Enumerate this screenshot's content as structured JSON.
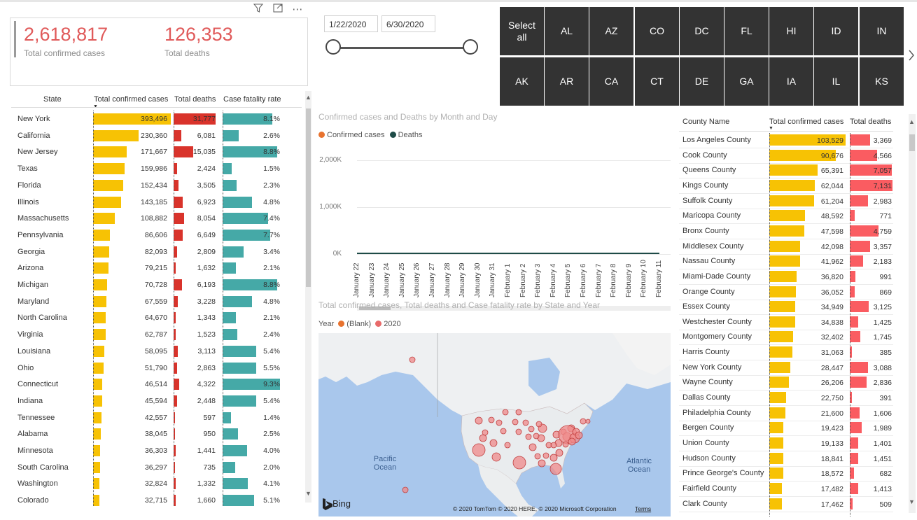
{
  "kpis": {
    "confirmed_value": "2,618,817",
    "confirmed_label": "Total confirmed cases",
    "deaths_value": "126,353",
    "deaths_label": "Total deaths"
  },
  "visual_icons": [
    "filter-icon",
    "focus-mode-icon",
    "more-options-icon"
  ],
  "date_slicer": {
    "start": "1/22/2020",
    "end": "6/30/2020"
  },
  "state_buttons": {
    "row1": [
      "Select all",
      "AL",
      "AZ",
      "CO",
      "DC",
      "FL",
      "HI",
      "ID",
      "IN"
    ],
    "row2": [
      "AK",
      "AR",
      "CA",
      "CT",
      "DE",
      "GA",
      "IA",
      "IL",
      "KS"
    ]
  },
  "state_table": {
    "headers": [
      "State",
      "Total confirmed cases",
      "Total deaths",
      "Case fatality rate"
    ],
    "rows": [
      {
        "state": "New York",
        "confirmed": "393,496",
        "deaths": "31,777",
        "cfr": "8.1%",
        "c": 393496,
        "d": 31777,
        "r": 8.1
      },
      {
        "state": "California",
        "confirmed": "230,360",
        "deaths": "6,081",
        "cfr": "2.6%",
        "c": 230360,
        "d": 6081,
        "r": 2.6
      },
      {
        "state": "New Jersey",
        "confirmed": "171,667",
        "deaths": "15,035",
        "cfr": "8.8%",
        "c": 171667,
        "d": 15035,
        "r": 8.8
      },
      {
        "state": "Texas",
        "confirmed": "159,986",
        "deaths": "2,424",
        "cfr": "1.5%",
        "c": 159986,
        "d": 2424,
        "r": 1.5
      },
      {
        "state": "Florida",
        "confirmed": "152,434",
        "deaths": "3,505",
        "cfr": "2.3%",
        "c": 152434,
        "d": 3505,
        "r": 2.3
      },
      {
        "state": "Illinois",
        "confirmed": "143,185",
        "deaths": "6,923",
        "cfr": "4.8%",
        "c": 143185,
        "d": 6923,
        "r": 4.8
      },
      {
        "state": "Massachusetts",
        "confirmed": "108,882",
        "deaths": "8,054",
        "cfr": "7.4%",
        "c": 108882,
        "d": 8054,
        "r": 7.4
      },
      {
        "state": "Pennsylvania",
        "confirmed": "86,606",
        "deaths": "6,649",
        "cfr": "7.7%",
        "c": 86606,
        "d": 6649,
        "r": 7.7
      },
      {
        "state": "Georgia",
        "confirmed": "82,093",
        "deaths": "2,809",
        "cfr": "3.4%",
        "c": 82093,
        "d": 2809,
        "r": 3.4
      },
      {
        "state": "Arizona",
        "confirmed": "79,215",
        "deaths": "1,632",
        "cfr": "2.1%",
        "c": 79215,
        "d": 1632,
        "r": 2.1
      },
      {
        "state": "Michigan",
        "confirmed": "70,728",
        "deaths": "6,193",
        "cfr": "8.8%",
        "c": 70728,
        "d": 6193,
        "r": 8.8
      },
      {
        "state": "Maryland",
        "confirmed": "67,559",
        "deaths": "3,228",
        "cfr": "4.8%",
        "c": 67559,
        "d": 3228,
        "r": 4.8
      },
      {
        "state": "North Carolina",
        "confirmed": "64,670",
        "deaths": "1,343",
        "cfr": "2.1%",
        "c": 64670,
        "d": 1343,
        "r": 2.1
      },
      {
        "state": "Virginia",
        "confirmed": "62,787",
        "deaths": "1,523",
        "cfr": "2.4%",
        "c": 62787,
        "d": 1523,
        "r": 2.4
      },
      {
        "state": "Louisiana",
        "confirmed": "58,095",
        "deaths": "3,113",
        "cfr": "5.4%",
        "c": 58095,
        "d": 3113,
        "r": 5.4
      },
      {
        "state": "Ohio",
        "confirmed": "51,790",
        "deaths": "2,863",
        "cfr": "5.5%",
        "c": 51790,
        "d": 2863,
        "r": 5.5
      },
      {
        "state": "Connecticut",
        "confirmed": "46,514",
        "deaths": "4,322",
        "cfr": "9.3%",
        "c": 46514,
        "d": 4322,
        "r": 9.3
      },
      {
        "state": "Indiana",
        "confirmed": "45,594",
        "deaths": "2,448",
        "cfr": "5.4%",
        "c": 45594,
        "d": 2448,
        "r": 5.4
      },
      {
        "state": "Tennessee",
        "confirmed": "42,557",
        "deaths": "597",
        "cfr": "1.4%",
        "c": 42557,
        "d": 597,
        "r": 1.4
      },
      {
        "state": "Alabama",
        "confirmed": "38,045",
        "deaths": "950",
        "cfr": "2.5%",
        "c": 38045,
        "d": 950,
        "r": 2.5
      },
      {
        "state": "Minnesota",
        "confirmed": "36,303",
        "deaths": "1,441",
        "cfr": "4.0%",
        "c": 36303,
        "d": 1441,
        "r": 4.0
      },
      {
        "state": "South Carolina",
        "confirmed": "36,297",
        "deaths": "735",
        "cfr": "2.0%",
        "c": 36297,
        "d": 735,
        "r": 2.0
      },
      {
        "state": "Washington",
        "confirmed": "32,824",
        "deaths": "1,332",
        "cfr": "4.1%",
        "c": 32824,
        "d": 1332,
        "r": 4.1
      },
      {
        "state": "Colorado",
        "confirmed": "32,715",
        "deaths": "1,660",
        "cfr": "5.1%",
        "c": 32715,
        "d": 1660,
        "r": 5.1
      }
    ]
  },
  "line_chart": {
    "title": "Confirmed cases and Deaths by Month and Day",
    "legend": [
      "Confirmed cases",
      "Deaths"
    ],
    "colors": {
      "confirmed": "#e8732f",
      "deaths": "#1e4b47"
    }
  },
  "chart_data": {
    "type": "line",
    "title": "Confirmed cases and Deaths by Month and Day",
    "x": [
      "January 22",
      "January 23",
      "January 24",
      "January 25",
      "January 26",
      "January 27",
      "January 28",
      "January 29",
      "January 30",
      "January 31",
      "February 1",
      "February 2",
      "February 3",
      "February 4",
      "February 5",
      "February 6",
      "February 7",
      "February 8",
      "February 9",
      "February 10",
      "February 11"
    ],
    "yticks": [
      "0K",
      "1,000K",
      "2,000K"
    ],
    "ylim": [
      0,
      2500000
    ],
    "series": [
      {
        "name": "Confirmed cases",
        "values": [
          0,
          0,
          0,
          0,
          0,
          0,
          0,
          0,
          0,
          0,
          0,
          0,
          0,
          0,
          0,
          0,
          0,
          0,
          0,
          0,
          0
        ]
      },
      {
        "name": "Deaths",
        "values": [
          0,
          0,
          0,
          0,
          0,
          0,
          0,
          0,
          0,
          0,
          0,
          0,
          0,
          0,
          0,
          0,
          0,
          0,
          0,
          0,
          0
        ]
      }
    ]
  },
  "map": {
    "title": "Total confirmed cases, Total deaths and Case fatality rate by State and Year",
    "legend_title": "Year",
    "legend": [
      "(Blank)",
      "2020"
    ],
    "colors": {
      "blank": "#e8732f",
      "y2020": "#e86a6a"
    },
    "labels": {
      "pacific": "Pacific\nOcean",
      "atlantic": "Atlantic\nOcean"
    },
    "logo": "Bing",
    "copyright": "© 2020 TomTom © 2020 HERE, © 2020 Microsoft Corporation",
    "terms": "Terms"
  },
  "county_table": {
    "headers": [
      "County Name",
      "Total confirmed cases",
      "Total deaths"
    ],
    "rows": [
      {
        "county": "Los Angeles County",
        "confirmed": "103,529",
        "deaths": "3,369",
        "c": 103529,
        "d": 3369
      },
      {
        "county": "Cook County",
        "confirmed": "90,676",
        "deaths": "4,566",
        "c": 90676,
        "d": 4566
      },
      {
        "county": "Queens County",
        "confirmed": "65,391",
        "deaths": "7,057",
        "c": 65391,
        "d": 7057
      },
      {
        "county": "Kings County",
        "confirmed": "62,044",
        "deaths": "7,131",
        "c": 62044,
        "d": 7131
      },
      {
        "county": "Suffolk County",
        "confirmed": "61,204",
        "deaths": "2,983",
        "c": 61204,
        "d": 2983
      },
      {
        "county": "Maricopa County",
        "confirmed": "48,592",
        "deaths": "771",
        "c": 48592,
        "d": 771
      },
      {
        "county": "Bronx County",
        "confirmed": "47,598",
        "deaths": "4,759",
        "c": 47598,
        "d": 4759
      },
      {
        "county": "Middlesex County",
        "confirmed": "42,098",
        "deaths": "3,357",
        "c": 42098,
        "d": 3357
      },
      {
        "county": "Nassau County",
        "confirmed": "41,962",
        "deaths": "2,183",
        "c": 41962,
        "d": 2183
      },
      {
        "county": "Miami-Dade County",
        "confirmed": "36,820",
        "deaths": "991",
        "c": 36820,
        "d": 991
      },
      {
        "county": "Orange County",
        "confirmed": "36,052",
        "deaths": "869",
        "c": 36052,
        "d": 869
      },
      {
        "county": "Essex County",
        "confirmed": "34,949",
        "deaths": "3,125",
        "c": 34949,
        "d": 3125
      },
      {
        "county": "Westchester County",
        "confirmed": "34,838",
        "deaths": "1,425",
        "c": 34838,
        "d": 1425
      },
      {
        "county": "Montgomery County",
        "confirmed": "32,402",
        "deaths": "1,745",
        "c": 32402,
        "d": 1745
      },
      {
        "county": "Harris County",
        "confirmed": "31,063",
        "deaths": "385",
        "c": 31063,
        "d": 385
      },
      {
        "county": "New York County",
        "confirmed": "28,447",
        "deaths": "3,088",
        "c": 28447,
        "d": 3088
      },
      {
        "county": "Wayne County",
        "confirmed": "26,206",
        "deaths": "2,836",
        "c": 26206,
        "d": 2836
      },
      {
        "county": "Dallas County",
        "confirmed": "22,750",
        "deaths": "391",
        "c": 22750,
        "d": 391
      },
      {
        "county": "Philadelphia County",
        "confirmed": "21,600",
        "deaths": "1,606",
        "c": 21600,
        "d": 1606
      },
      {
        "county": "Bergen County",
        "confirmed": "19,423",
        "deaths": "1,989",
        "c": 19423,
        "d": 1989
      },
      {
        "county": "Union County",
        "confirmed": "19,133",
        "deaths": "1,401",
        "c": 19133,
        "d": 1401
      },
      {
        "county": "Hudson County",
        "confirmed": "18,841",
        "deaths": "1,451",
        "c": 18841,
        "d": 1451
      },
      {
        "county": "Prince George's County",
        "confirmed": "18,572",
        "deaths": "682",
        "c": 18572,
        "d": 682
      },
      {
        "county": "Fairfield County",
        "confirmed": "17,482",
        "deaths": "1,413",
        "c": 17482,
        "d": 1413
      },
      {
        "county": "Clark County",
        "confirmed": "17,462",
        "deaths": "509",
        "c": 17462,
        "d": 509
      }
    ]
  }
}
